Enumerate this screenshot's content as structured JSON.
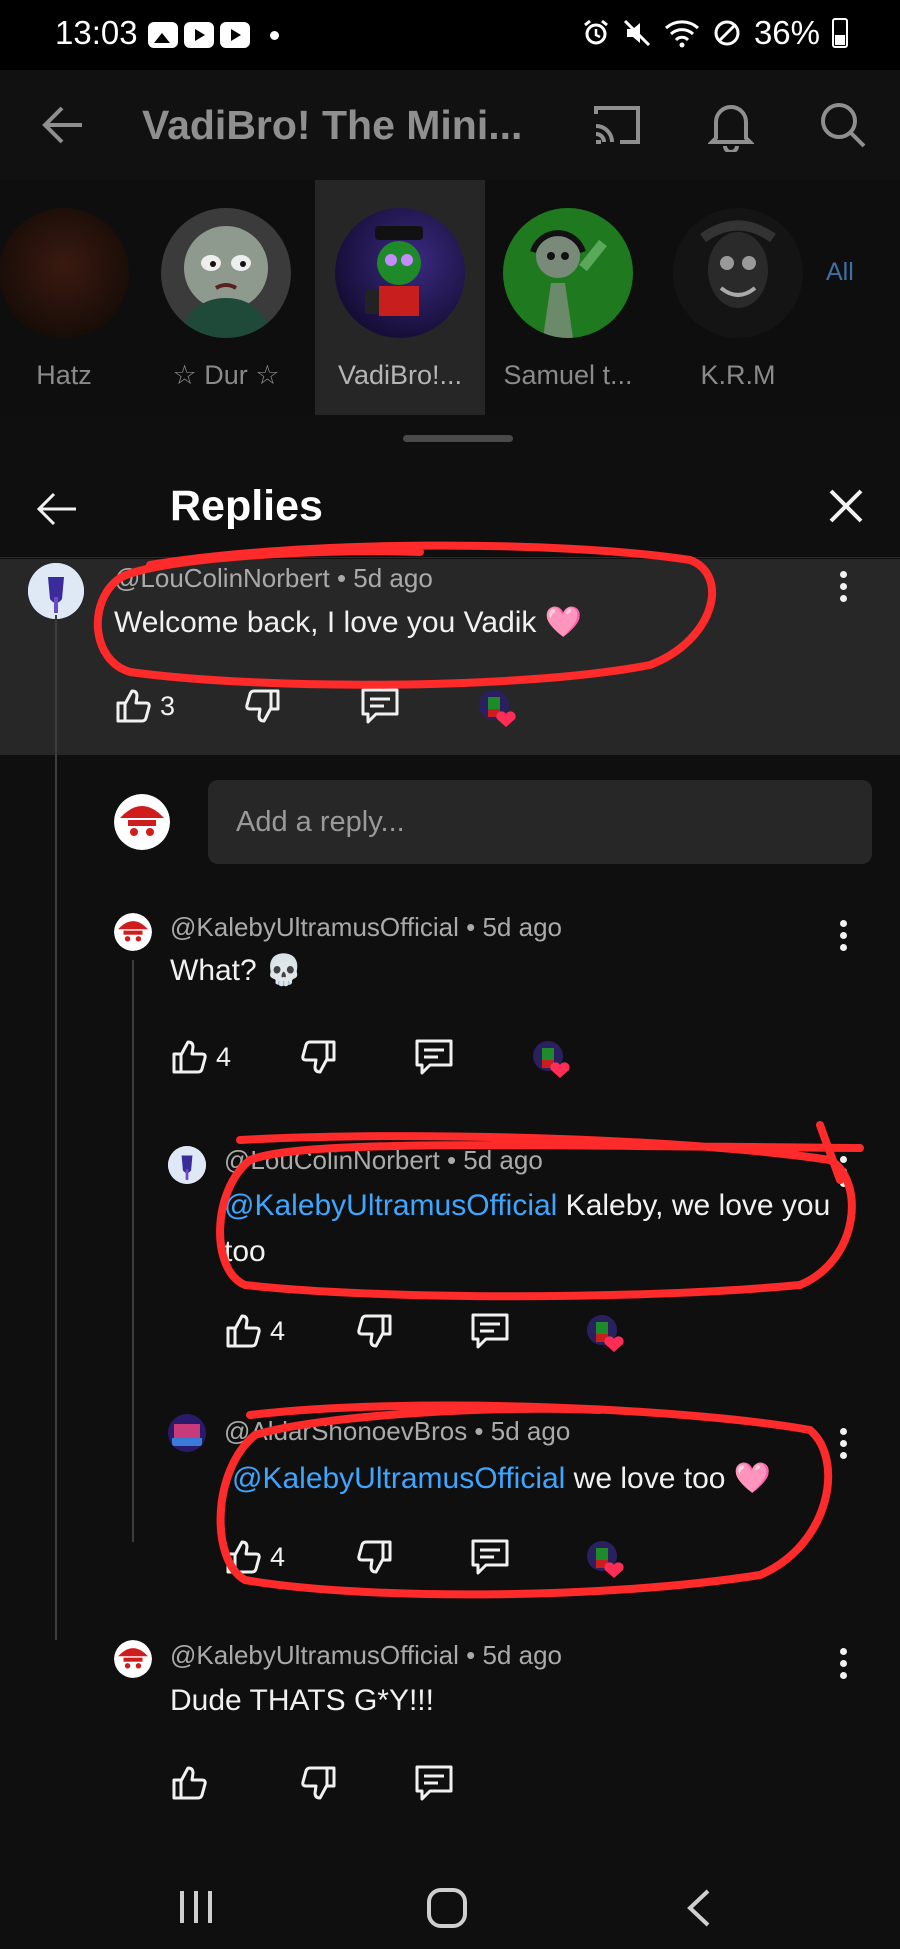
{
  "status_bar": {
    "time": "13:03",
    "battery": "36%"
  },
  "app_header": {
    "title": "VadiBro! The Mini..."
  },
  "channels": {
    "items": [
      {
        "name": "Hatz",
        "selected": false
      },
      {
        "name": "☆ Dur ☆",
        "selected": false
      },
      {
        "name": "VadiBro!...",
        "selected": true
      },
      {
        "name": "Samuel t...",
        "selected": false
      },
      {
        "name": "K.R.M",
        "selected": false
      }
    ],
    "all_label": "All"
  },
  "sheet": {
    "title": "Replies"
  },
  "parent_comment": {
    "author": "@LouColinNorbert",
    "time": "5d ago",
    "text": "Welcome back, I love you Vadik 🩷",
    "likes": "3"
  },
  "reply_input": {
    "placeholder": "Add a reply..."
  },
  "replies": [
    {
      "author": "@KalebyUltramusOfficial",
      "time": "5d ago",
      "text": "What? 💀",
      "likes": "4"
    },
    {
      "author": "@LouColinNorbert",
      "time": "5d ago",
      "mention": "@KalebyUltramusOfficial",
      "text": " Kaleby, we love you too",
      "likes": "4"
    },
    {
      "author": "@AldarShonoevBros",
      "time": "5d ago",
      "mention": "@KalebyUltramusOfficial",
      "text": " we love too 🩷",
      "likes": "4"
    },
    {
      "author": "@KalebyUltramusOfficial",
      "time": "5d ago",
      "text": "Dude THATS G*Y!!!",
      "likes": ""
    }
  ],
  "meta_separator": " • ",
  "colors": {
    "background": "#0f0f0f",
    "highlight_block": "#272727",
    "mention": "#3ea6ff",
    "annotation_red": "#ff2a2a",
    "heart": "#ff2d55"
  }
}
